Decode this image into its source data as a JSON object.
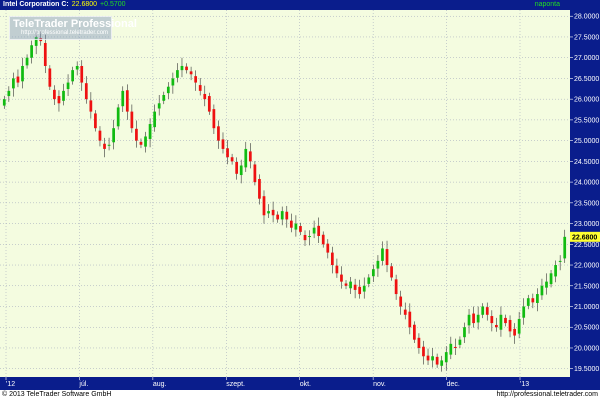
{
  "header": {
    "label": "Intel Corporation C:",
    "price": "22.6800",
    "change": "+0.5700",
    "interval": "naponta"
  },
  "logo": {
    "name": "TeleTrader Professional",
    "url": "http://professional.teletrader.com"
  },
  "footer": {
    "copyright": "© 2013 TeleTrader Software GmbH",
    "url": "http://professional.teletrader.com"
  },
  "colors": {
    "background": "#f4fce0",
    "up": "#11bb11",
    "down": "#ee1111",
    "grid": "#9aa0b8",
    "axis_panel": "#0a1d8c",
    "price_tag": "#ffff33"
  },
  "chart_data": {
    "type": "candlestick",
    "ylim": [
      19.3,
      28.15
    ],
    "y_ticks": [
      "28.0000",
      "27.5000",
      "27.0000",
      "26.5000",
      "26.0000",
      "25.5000",
      "25.0000",
      "24.5000",
      "24.0000",
      "23.5000",
      "23.0000",
      "22.5000",
      "22.0000",
      "21.5000",
      "21.0000",
      "20.5000",
      "20.0000",
      "19.5000"
    ],
    "x_tick_labels": [
      "'12",
      "júl.",
      "aug.",
      "szept.",
      "okt.",
      "nov.",
      "dec.",
      "'13"
    ],
    "last_price_label": "22.6800",
    "last_price": 22.68,
    "grid": true,
    "closes": [
      26.0,
      26.2,
      26.5,
      26.4,
      26.8,
      27.0,
      27.3,
      27.5,
      27.4,
      26.8,
      26.3,
      26.0,
      25.9,
      26.2,
      26.4,
      26.7,
      26.8,
      26.4,
      26.0,
      25.7,
      25.3,
      25.0,
      24.8,
      24.9,
      25.3,
      25.8,
      26.2,
      25.7,
      25.3,
      25.0,
      24.9,
      25.1,
      25.4,
      25.7,
      25.9,
      26.1,
      26.3,
      26.5,
      26.7,
      26.8,
      26.7,
      26.6,
      26.4,
      26.2,
      26.0,
      25.7,
      25.3,
      25.0,
      24.8,
      24.6,
      24.5,
      24.2,
      24.4,
      24.8,
      24.5,
      24.0,
      23.6,
      23.2,
      23.3,
      23.2,
      23.1,
      23.3,
      23.1,
      22.9,
      23.0,
      22.8,
      22.6,
      22.7,
      22.9,
      22.7,
      22.5,
      22.3,
      22.0,
      21.8,
      21.6,
      21.5,
      21.6,
      21.4,
      21.3,
      21.5,
      21.7,
      21.9,
      22.1,
      22.4,
      22.0,
      21.7,
      21.3,
      21.0,
      20.8,
      20.5,
      20.2,
      20.0,
      19.8,
      19.7,
      19.8,
      19.6,
      19.7,
      19.9,
      20.1,
      20.0,
      20.2,
      20.5,
      20.8,
      20.6,
      20.8,
      21.0,
      20.8,
      20.6,
      20.5,
      20.8,
      20.6,
      20.4,
      20.3,
      20.7,
      21.0,
      21.2,
      21.1,
      21.3,
      21.5,
      21.6,
      21.8,
      22.0,
      22.1,
      22.68
    ]
  }
}
